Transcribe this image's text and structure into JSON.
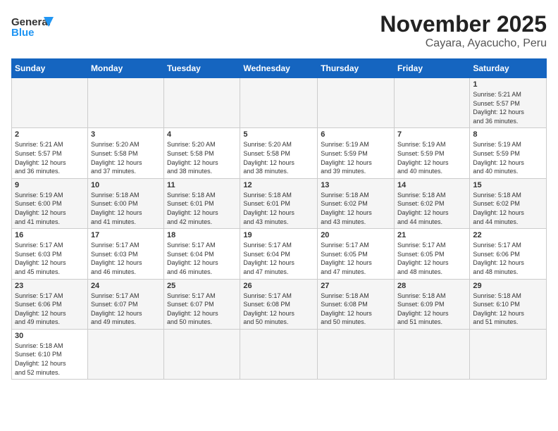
{
  "header": {
    "logo_general": "General",
    "logo_blue": "Blue",
    "title": "November 2025",
    "subtitle": "Cayara, Ayacucho, Peru"
  },
  "weekdays": [
    "Sunday",
    "Monday",
    "Tuesday",
    "Wednesday",
    "Thursday",
    "Friday",
    "Saturday"
  ],
  "weeks": [
    [
      {
        "day": "",
        "info": ""
      },
      {
        "day": "",
        "info": ""
      },
      {
        "day": "",
        "info": ""
      },
      {
        "day": "",
        "info": ""
      },
      {
        "day": "",
        "info": ""
      },
      {
        "day": "",
        "info": ""
      },
      {
        "day": "1",
        "info": "Sunrise: 5:21 AM\nSunset: 5:57 PM\nDaylight: 12 hours\nand 36 minutes."
      }
    ],
    [
      {
        "day": "2",
        "info": "Sunrise: 5:21 AM\nSunset: 5:57 PM\nDaylight: 12 hours\nand 36 minutes."
      },
      {
        "day": "3",
        "info": "Sunrise: 5:20 AM\nSunset: 5:58 PM\nDaylight: 12 hours\nand 37 minutes."
      },
      {
        "day": "4",
        "info": "Sunrise: 5:20 AM\nSunset: 5:58 PM\nDaylight: 12 hours\nand 38 minutes."
      },
      {
        "day": "5",
        "info": "Sunrise: 5:20 AM\nSunset: 5:58 PM\nDaylight: 12 hours\nand 38 minutes."
      },
      {
        "day": "6",
        "info": "Sunrise: 5:19 AM\nSunset: 5:59 PM\nDaylight: 12 hours\nand 39 minutes."
      },
      {
        "day": "7",
        "info": "Sunrise: 5:19 AM\nSunset: 5:59 PM\nDaylight: 12 hours\nand 40 minutes."
      },
      {
        "day": "8",
        "info": "Sunrise: 5:19 AM\nSunset: 5:59 PM\nDaylight: 12 hours\nand 40 minutes."
      }
    ],
    [
      {
        "day": "9",
        "info": "Sunrise: 5:19 AM\nSunset: 6:00 PM\nDaylight: 12 hours\nand 41 minutes."
      },
      {
        "day": "10",
        "info": "Sunrise: 5:18 AM\nSunset: 6:00 PM\nDaylight: 12 hours\nand 41 minutes."
      },
      {
        "day": "11",
        "info": "Sunrise: 5:18 AM\nSunset: 6:01 PM\nDaylight: 12 hours\nand 42 minutes."
      },
      {
        "day": "12",
        "info": "Sunrise: 5:18 AM\nSunset: 6:01 PM\nDaylight: 12 hours\nand 43 minutes."
      },
      {
        "day": "13",
        "info": "Sunrise: 5:18 AM\nSunset: 6:02 PM\nDaylight: 12 hours\nand 43 minutes."
      },
      {
        "day": "14",
        "info": "Sunrise: 5:18 AM\nSunset: 6:02 PM\nDaylight: 12 hours\nand 44 minutes."
      },
      {
        "day": "15",
        "info": "Sunrise: 5:18 AM\nSunset: 6:02 PM\nDaylight: 12 hours\nand 44 minutes."
      }
    ],
    [
      {
        "day": "16",
        "info": "Sunrise: 5:17 AM\nSunset: 6:03 PM\nDaylight: 12 hours\nand 45 minutes."
      },
      {
        "day": "17",
        "info": "Sunrise: 5:17 AM\nSunset: 6:03 PM\nDaylight: 12 hours\nand 46 minutes."
      },
      {
        "day": "18",
        "info": "Sunrise: 5:17 AM\nSunset: 6:04 PM\nDaylight: 12 hours\nand 46 minutes."
      },
      {
        "day": "19",
        "info": "Sunrise: 5:17 AM\nSunset: 6:04 PM\nDaylight: 12 hours\nand 47 minutes."
      },
      {
        "day": "20",
        "info": "Sunrise: 5:17 AM\nSunset: 6:05 PM\nDaylight: 12 hours\nand 47 minutes."
      },
      {
        "day": "21",
        "info": "Sunrise: 5:17 AM\nSunset: 6:05 PM\nDaylight: 12 hours\nand 48 minutes."
      },
      {
        "day": "22",
        "info": "Sunrise: 5:17 AM\nSunset: 6:06 PM\nDaylight: 12 hours\nand 48 minutes."
      }
    ],
    [
      {
        "day": "23",
        "info": "Sunrise: 5:17 AM\nSunset: 6:06 PM\nDaylight: 12 hours\nand 49 minutes."
      },
      {
        "day": "24",
        "info": "Sunrise: 5:17 AM\nSunset: 6:07 PM\nDaylight: 12 hours\nand 49 minutes."
      },
      {
        "day": "25",
        "info": "Sunrise: 5:17 AM\nSunset: 6:07 PM\nDaylight: 12 hours\nand 50 minutes."
      },
      {
        "day": "26",
        "info": "Sunrise: 5:17 AM\nSunset: 6:08 PM\nDaylight: 12 hours\nand 50 minutes."
      },
      {
        "day": "27",
        "info": "Sunrise: 5:18 AM\nSunset: 6:08 PM\nDaylight: 12 hours\nand 50 minutes."
      },
      {
        "day": "28",
        "info": "Sunrise: 5:18 AM\nSunset: 6:09 PM\nDaylight: 12 hours\nand 51 minutes."
      },
      {
        "day": "29",
        "info": "Sunrise: 5:18 AM\nSunset: 6:10 PM\nDaylight: 12 hours\nand 51 minutes."
      }
    ],
    [
      {
        "day": "30",
        "info": "Sunrise: 5:18 AM\nSunset: 6:10 PM\nDaylight: 12 hours\nand 52 minutes."
      },
      {
        "day": "",
        "info": ""
      },
      {
        "day": "",
        "info": ""
      },
      {
        "day": "",
        "info": ""
      },
      {
        "day": "",
        "info": ""
      },
      {
        "day": "",
        "info": ""
      },
      {
        "day": "",
        "info": ""
      }
    ]
  ]
}
